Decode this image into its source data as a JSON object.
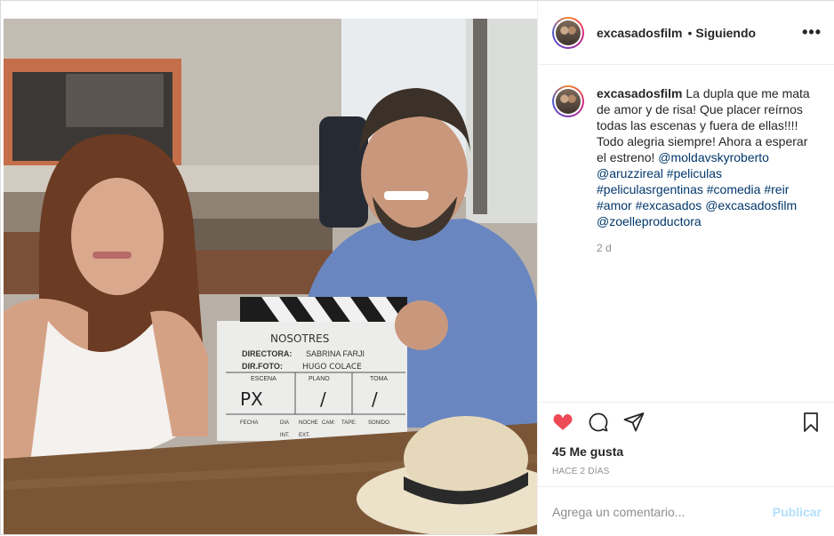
{
  "post": {
    "username": "excasadosfilm",
    "follow_status": "Siguiendo",
    "more_options": "•••",
    "caption": {
      "text_1": "La dupla que me mata de amor y de risa! Que placer reírnos todas las escenas y fuera de ellas!!!! Todo alegria siempre! Ahora a esperar el estreno! ",
      "mention_1": "@moldavskyroberto",
      "mention_2": "@aruzzireal",
      "tag_1": "#peliculas",
      "tag_2": "#peliculasrgentinas",
      "tag_3": "#comedia",
      "tag_4": "#reir",
      "tag_5": "#amor",
      "tag_6": "#excasados",
      "mention_3": "@excasadosfilm",
      "mention_4": "@zoelleproductora",
      "age": "2 d"
    },
    "likes": "45 Me gusta",
    "posted_ago": "HACE 2 DÍAS",
    "comment_placeholder": "Agrega un comentario...",
    "publish_label": "Publicar",
    "liked": true
  },
  "photo": {
    "clapper": {
      "title": "NOSOTRES",
      "director_label": "DIRECTORA:",
      "director": "SABRINA FARJI",
      "dp_label": "DIR.FOTO:",
      "dp": "HUGO COLACE",
      "col_1": "ESCENA",
      "col_2": "PLANO",
      "col_3": "TOMA",
      "val_1": "PX",
      "val_2": "/",
      "val_3": "/",
      "footer_1": "FECHA",
      "footer_2": "DIA",
      "footer_3": "NOCHE",
      "footer_4": "CAM:",
      "footer_5": "TAPE:",
      "footer_6": "SONIDO:",
      "footer_7": "INT.",
      "footer_8": "EXT."
    }
  },
  "colors": {
    "heart": "#ed4956",
    "link": "#00376b",
    "publish_disabled": "#b2dffc"
  },
  "icons": [
    "heart-icon",
    "comment-icon",
    "share-icon",
    "bookmark-icon",
    "more-options-icon"
  ]
}
